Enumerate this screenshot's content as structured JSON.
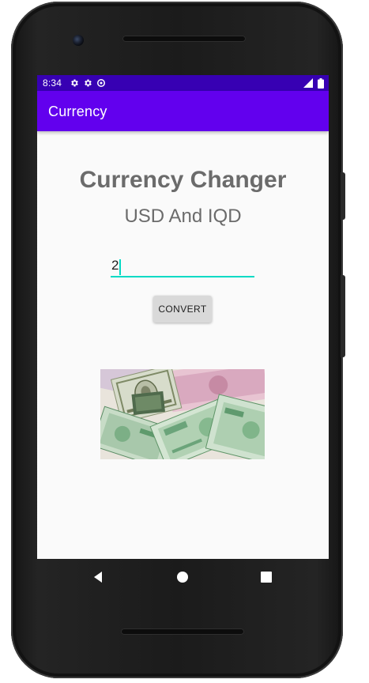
{
  "status_bar": {
    "time": "8:34",
    "left_icons": [
      "settings-icon",
      "settings-icon",
      "data-saver-icon"
    ],
    "right_icons": [
      "signal-icon",
      "battery-icon"
    ],
    "color": "#3700b3"
  },
  "app_bar": {
    "title": "Currency",
    "color": "#6200ee"
  },
  "main": {
    "heading": "Currency Changer",
    "subheading": "USD And IQD",
    "amount_value": "2",
    "convert_label": "CONVERT",
    "image_icon": "banknotes-image",
    "accent_color": "#03dac5"
  },
  "navigation": {
    "icons": [
      "back-icon",
      "home-icon",
      "recents-icon"
    ]
  }
}
